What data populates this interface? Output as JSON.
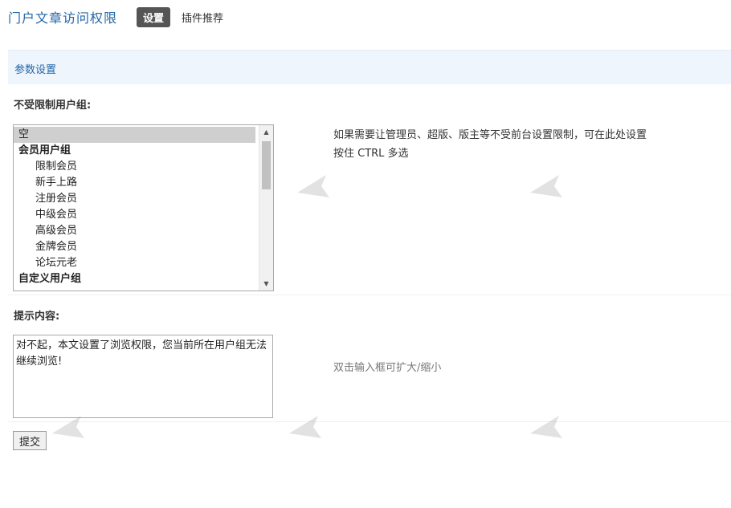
{
  "header": {
    "title": "门户文章访问权限",
    "tabs": [
      {
        "label": "设置",
        "active": true
      },
      {
        "label": "插件推荐",
        "active": false
      }
    ]
  },
  "section": {
    "title": "参数设置"
  },
  "groups_field": {
    "label": "不受限制用户组:",
    "options": [
      "空",
      "会员用户组",
      "限制会员",
      "新手上路",
      "注册会员",
      "中级会员",
      "高级会员",
      "金牌会员",
      "论坛元老",
      "自定义用户组"
    ],
    "selected": "空",
    "description_line1": "如果需要让管理员、超版、版主等不受前台设置限制，可在此处设置",
    "description_line2": "按住 CTRL 多选"
  },
  "message_field": {
    "label": "提示内容:",
    "value": "对不起，本文设置了浏览权限，您当前所在用户组无法继续浏览!",
    "hint": "双击输入框可扩大/缩小"
  },
  "submit_label": "提交",
  "colors": {
    "title": "#2366a8",
    "section_bg": "#eef5fd",
    "active_tab": "#555555"
  }
}
